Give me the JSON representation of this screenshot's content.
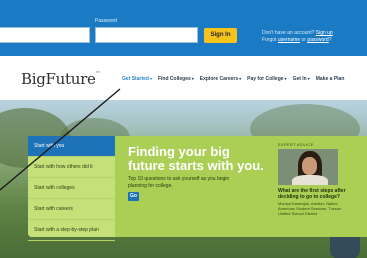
{
  "login": {
    "password_label": "Password",
    "username_value": "",
    "password_value": "",
    "signin_label": "Sign In",
    "account_prompt": "Don't have an account?",
    "signup_link": "Sign up",
    "forgot_prefix": "Forgot",
    "username_link": "username",
    "or_text": "or",
    "password_link": "password",
    "forgot_suffix": "?"
  },
  "header": {
    "logo": "BigFuture",
    "logo_mark": "™"
  },
  "nav": {
    "items": [
      {
        "label": "Get Started",
        "caret": "▾"
      },
      {
        "label": "Find Colleges",
        "caret": "▾"
      },
      {
        "label": "Explore Careers",
        "caret": "▾"
      },
      {
        "label": "Pay for College",
        "caret": "▾"
      },
      {
        "label": "Get In",
        "caret": "▾"
      },
      {
        "label": "Make a Plan",
        "caret": ""
      }
    ]
  },
  "hero": {
    "side_items": [
      "Start with you",
      "Start with how others did it",
      "Start with colleges",
      "Start with careers",
      "Start with a step-by-step plan"
    ],
    "headline_line1": "Finding your big",
    "headline_line2": "future starts with you.",
    "subtext_line1": "Top 10 questions to ask yourself as you begin",
    "subtext_line2": "planning for college.",
    "go_label": "Go",
    "advice": {
      "label": "EXPERT ADVICE",
      "question_line1": "What are the first steps after",
      "question_line2": "deciding to go to college?",
      "credit_line1": "Monica Karamjok, Adviser, Native",
      "credit_line2": "American Student Services, Tucson",
      "credit_line3": "Unified School District"
    }
  },
  "colors": {
    "login_bar": "#1a7bc4",
    "signin_button": "#f6c21c",
    "panel_green": "#aacf54",
    "active_item": "#1d72b8",
    "nav_active": "#2a84c6"
  }
}
